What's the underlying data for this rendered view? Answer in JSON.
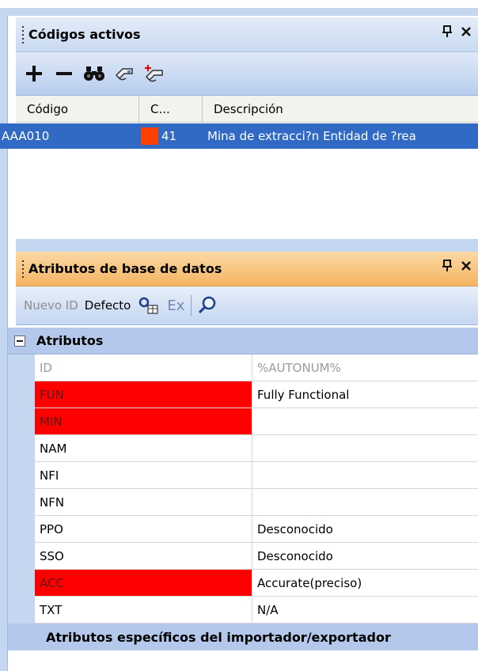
{
  "panel1": {
    "title": "Códigos activos",
    "pin": " ",
    "toolbar": {
      "add": "+",
      "remove": "—"
    },
    "columns": [
      "Código",
      "C...",
      "Descripción"
    ],
    "rows": [
      {
        "code": "AAA010",
        "num": "41",
        "desc": "Mina de extracci?n Entidad de ?rea",
        "swatch_color": "#ff4000"
      }
    ]
  },
  "panel2": {
    "title": "Atributos de base de datos",
    "toolbar": {
      "nuevo_id": "Nuevo ID",
      "defecto": "Defecto",
      "ex": "Ex"
    },
    "category": "Atributos",
    "attributes": [
      {
        "name": "ID",
        "value": "%AUTONUM%"
      },
      {
        "name": "FUN",
        "value": "Fully Functional"
      },
      {
        "name": "MIN",
        "value": ""
      },
      {
        "name": "NAM",
        "value": ""
      },
      {
        "name": "NFI",
        "value": ""
      },
      {
        "name": "NFN",
        "value": ""
      },
      {
        "name": "PPO",
        "value": "Desconocido"
      },
      {
        "name": "SSO",
        "value": "Desconocido"
      },
      {
        "name": "ACC",
        "value": "Accurate(preciso)"
      },
      {
        "name": "TXT",
        "value": "N/A"
      }
    ],
    "category2": "Atributos específicos del importador/exportador"
  },
  "colors": {
    "selection": "#316ac5",
    "active_title": "#f5b461",
    "required": "#ff0000"
  }
}
